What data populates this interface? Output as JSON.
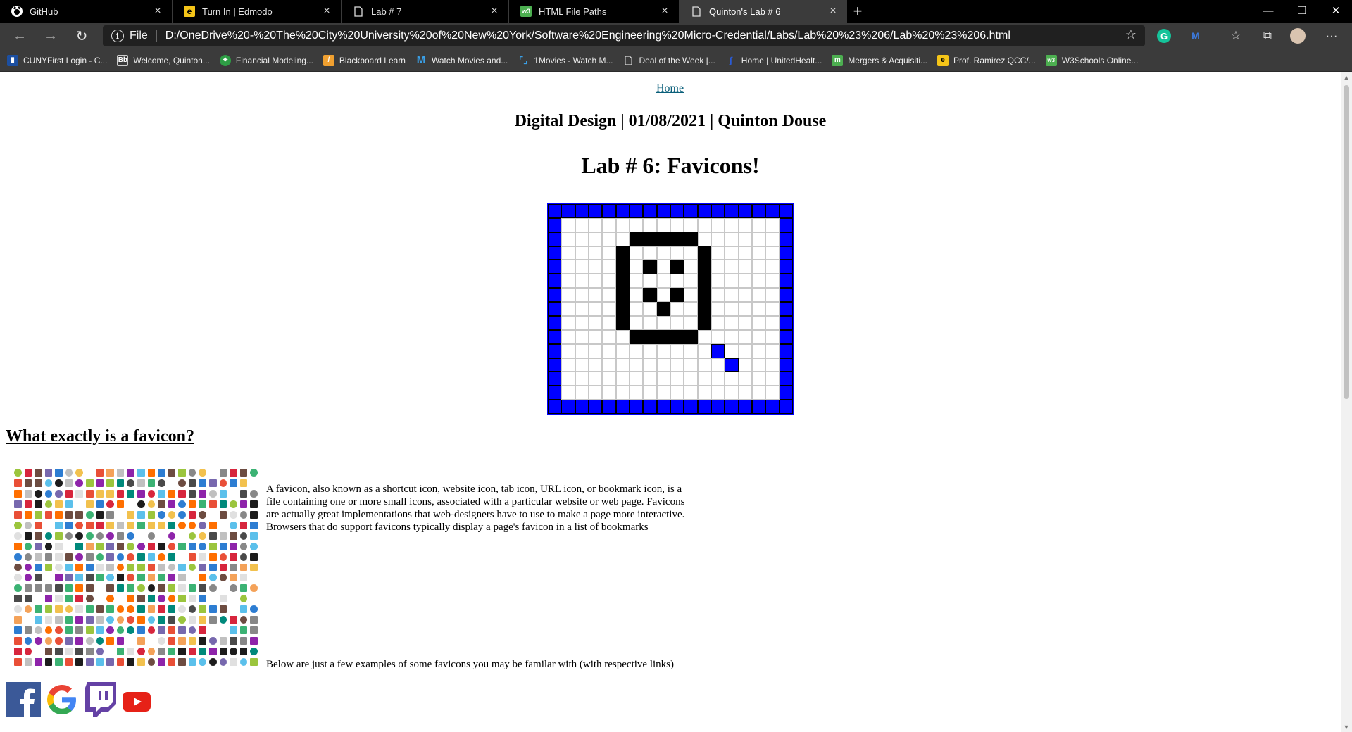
{
  "tabs": [
    {
      "title": "GitHub",
      "icon": "github-icon"
    },
    {
      "title": "Turn In | Edmodo",
      "icon": "edmodo-icon"
    },
    {
      "title": "Lab # 7",
      "icon": "page-icon"
    },
    {
      "title": "HTML File Paths",
      "icon": "w3schools-icon"
    },
    {
      "title": "Quinton's Lab # 6",
      "icon": "page-icon",
      "active": true
    }
  ],
  "address_bar": {
    "scheme_label": "File",
    "url": "D:/OneDrive%20-%20The%20City%20University%20of%20New%20York/Software%20Engineering%20Micro-Credential/Labs/Lab%20%23%206/Lab%20%23%206.html"
  },
  "bookmarks": [
    {
      "label": "CUNYFirst Login - C...",
      "icon": "cuny-icon"
    },
    {
      "label": "Welcome, Quinton...",
      "icon": "blackboard-bb-icon"
    },
    {
      "label": "Financial Modeling...",
      "icon": "fmi-icon"
    },
    {
      "label": "Blackboard Learn",
      "icon": "blackboard-icon"
    },
    {
      "label": "Watch Movies and...",
      "icon": "m-icon"
    },
    {
      "label": "1Movies - Watch M...",
      "icon": "brackets-icon"
    },
    {
      "label": "Deal of the Week |...",
      "icon": "page-icon"
    },
    {
      "label": "Home | UnitedHealt...",
      "icon": "unitedhealth-icon"
    },
    {
      "label": "Mergers & Acquisiti...",
      "icon": "m-green-icon"
    },
    {
      "label": "Prof. Ramirez QCC/...",
      "icon": "edmodo-icon"
    },
    {
      "label": "W3Schools Online...",
      "icon": "w3schools-icon"
    }
  ],
  "page": {
    "home_link": "Home",
    "byline": "Digital Design | 01/08/2021 | Quinton Douse",
    "title": "Lab # 6: Favicons!",
    "section_heading": "What exactly is a favicon?",
    "description": "A favicon, also known as a shortcut icon, website icon, tab icon, URL icon, or bookmark icon, is a file containing one or more small icons, associated with a particular website or web page. Favicons are actually great implementations that web-designers have to use to make a page more interactive. Browsers that do support favicons typically display a page's favicon in a list of bookmarks",
    "examples_text": "Below are just a few examples of some favicons you may be familar with (with respective links)",
    "example_logos": [
      "facebook-icon",
      "google-icon",
      "twitch-icon",
      "youtube-icon"
    ]
  },
  "colors": {
    "grid_blue": "#0000ff",
    "grid_black": "#000000",
    "link": "#0a5f7a"
  }
}
